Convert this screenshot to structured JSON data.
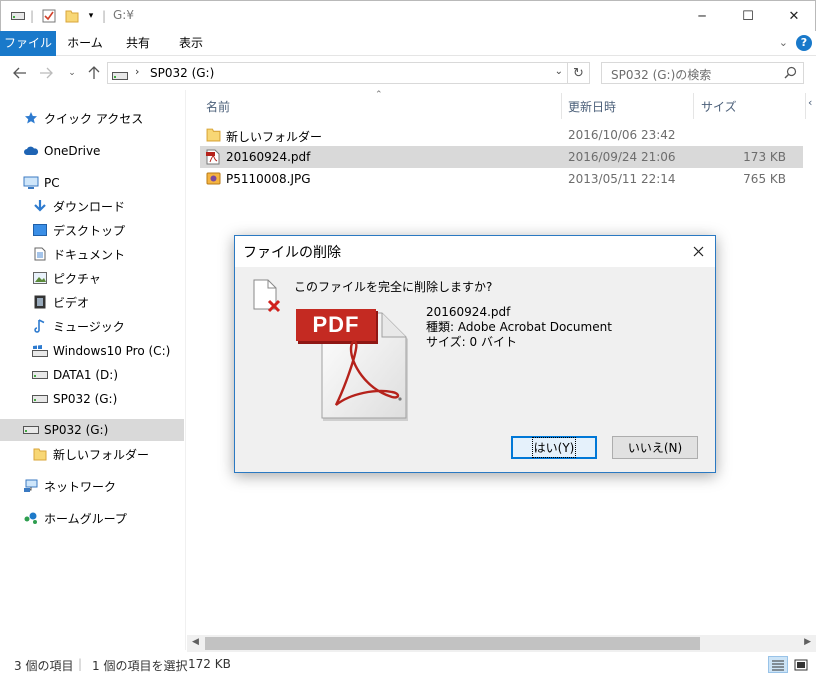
{
  "window": {
    "title": "G:¥",
    "controls": {
      "minimize": "─",
      "maximize": "☐",
      "close": "✕"
    }
  },
  "ribbon": {
    "tabs": [
      {
        "label": "ファイル"
      },
      {
        "label": "ホーム"
      },
      {
        "label": "共有"
      },
      {
        "label": "表示"
      }
    ]
  },
  "address": {
    "path": "SP032 (G:)",
    "search_placeholder": "SP032 (G:)の検索"
  },
  "sidebar": {
    "items": [
      {
        "label": "クイック アクセス",
        "icon": "star-icon"
      },
      {
        "label": "OneDrive",
        "icon": "cloud-icon"
      },
      {
        "label": "PC",
        "icon": "monitor-icon"
      },
      {
        "label": "ダウンロード",
        "icon": "download-icon"
      },
      {
        "label": "デスクトップ",
        "icon": "desktop-icon"
      },
      {
        "label": "ドキュメント",
        "icon": "document-icon"
      },
      {
        "label": "ピクチャ",
        "icon": "picture-icon"
      },
      {
        "label": "ビデオ",
        "icon": "video-icon"
      },
      {
        "label": "ミュージック",
        "icon": "music-icon"
      },
      {
        "label": "Windows10 Pro (C:)",
        "icon": "system-drive-icon"
      },
      {
        "label": "DATA1 (D:)",
        "icon": "drive-icon"
      },
      {
        "label": "SP032 (G:)",
        "icon": "drive-icon"
      },
      {
        "label": "SP032 (G:)",
        "icon": "drive-icon"
      },
      {
        "label": "新しいフォルダー",
        "icon": "folder-icon"
      },
      {
        "label": "ネットワーク",
        "icon": "network-icon"
      },
      {
        "label": "ホームグループ",
        "icon": "homegroup-icon"
      }
    ]
  },
  "filelist": {
    "columns": {
      "name": "名前",
      "date": "更新日時",
      "size": "サイズ"
    },
    "rows": [
      {
        "name": "新しいフォルダー",
        "date": "2016/10/06 23:42",
        "size": "",
        "icon": "folder-icon"
      },
      {
        "name": "20160924.pdf",
        "date": "2016/09/24 21:06",
        "size": "173 KB",
        "icon": "pdf-icon"
      },
      {
        "name": "P5110008.JPG",
        "date": "2013/05/11 22:14",
        "size": "765 KB",
        "icon": "image-file-icon"
      }
    ]
  },
  "status": {
    "count": "3 個の項目",
    "selected": "1 個の項目を選択",
    "selected_size": "172 KB"
  },
  "dialog": {
    "title": "ファイルの削除",
    "question": "このファイルを完全に削除しますか?",
    "file_name": "20160924.pdf",
    "file_type": "種類: Adobe Acrobat Document",
    "file_size": "サイズ: 0 バイト",
    "pdf_badge": "PDF",
    "yes_label": "はい(Y)",
    "no_label": "いいえ(N)"
  },
  "colors": {
    "accent": "#1979ca",
    "selection": "#d9d9d9",
    "dialog_border": "#2b79c2",
    "pdf_red": "#b5221b"
  }
}
